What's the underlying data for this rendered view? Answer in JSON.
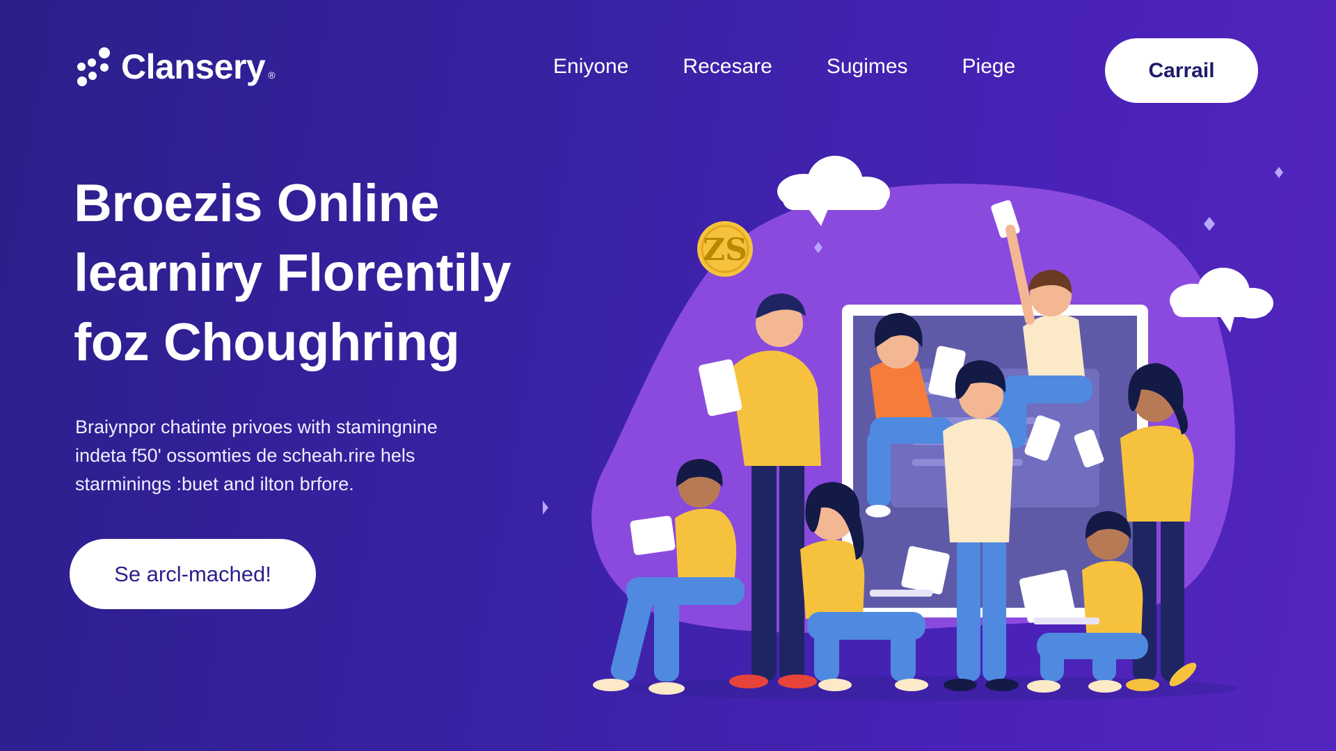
{
  "brand": {
    "name": "Clansery",
    "reg_mark": "®",
    "icon": "dots-cluster-icon"
  },
  "nav": {
    "items": [
      {
        "label": "Eniyone"
      },
      {
        "label": "Recesare"
      },
      {
        "label": "Sugimes"
      },
      {
        "label": "Piege"
      }
    ],
    "cta_label": "Carrail"
  },
  "hero": {
    "title_lines": [
      "Broezis Online",
      "learniry Florentily",
      "foz Choughring"
    ],
    "description_lines": [
      "Braiynpor chatinte privoes with stamingnine",
      "indeta f50' ossomties de scheah.rire hels",
      "starminings :buet and ilton brfore."
    ],
    "cta_label": "Se arcl-mached!"
  },
  "illustration": {
    "coin_label": "ZS",
    "icons": [
      "cloud-icon",
      "coin-icon",
      "sparkle-icon",
      "laptop-icon",
      "tablet-icon",
      "monitor-icon"
    ]
  },
  "colors": {
    "background_start": "#2a1f8a",
    "background_end": "#5326bd",
    "blob": "#8e4de0",
    "accent_yellow": "#f6c23e",
    "button_text": "#1f1a6b",
    "white": "#ffffff"
  }
}
